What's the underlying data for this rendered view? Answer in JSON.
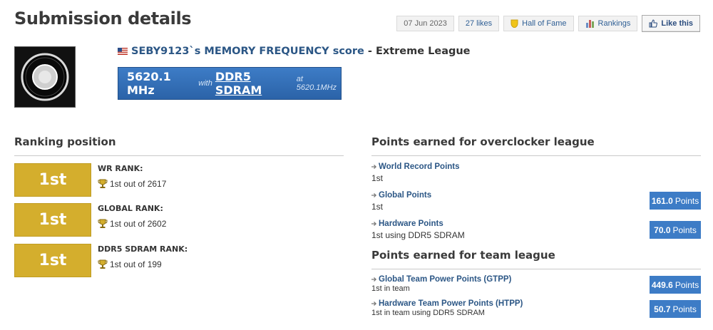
{
  "page_title": "Submission details",
  "top_bar": {
    "date": "07 Jun 2023",
    "likes": "27 likes",
    "hall_of_fame": "Hall of Fame",
    "rankings": "Rankings",
    "like_this": "Like this"
  },
  "submission": {
    "user_score": "SEBY9123`s MEMORY FREQUENCY score",
    "league": "- Extreme League",
    "score_value": "5620.1 MHz",
    "with_text": "with",
    "memory_type": "DDR5 SDRAM",
    "at_text": "at 5620.1MHz"
  },
  "ranking": {
    "title": "Ranking position",
    "rows": [
      {
        "position": "1st",
        "label": "WR RANK:",
        "detail": "1st out of 2617"
      },
      {
        "position": "1st",
        "label": "GLOBAL RANK:",
        "detail": "1st out of 2602"
      },
      {
        "position": "1st",
        "label": "DDR5 SDRAM RANK:",
        "detail": "1st out of 199"
      }
    ]
  },
  "overclocker_league": {
    "title": "Points earned for overclocker league",
    "items": [
      {
        "title": "World Record Points",
        "sub": "1st",
        "points": "",
        "unit": ""
      },
      {
        "title": "Global Points",
        "sub": "1st",
        "points": "161.0",
        "unit": "Points"
      },
      {
        "title": "Hardware Points",
        "sub": "1st using DDR5 SDRAM",
        "points": "70.0",
        "unit": "Points"
      }
    ]
  },
  "team_league": {
    "title": "Points earned for team league",
    "items": [
      {
        "title": "Global Team Power Points (GTPP)",
        "sub": "1st in team",
        "points": "449.6",
        "unit": "Points"
      },
      {
        "title": "Hardware Team Power Points (HTPP)",
        "sub": "1st in team using DDR5 SDRAM",
        "points": "50.7",
        "unit": "Points"
      }
    ]
  },
  "colors": {
    "gold": "#d4ae2d",
    "blue": "#3d7cc6",
    "link": "#2b5685"
  },
  "icons": [
    "hall-of-fame-icon",
    "rankings-icon",
    "thumbs-up-icon",
    "flag-icon",
    "trophy-icon",
    "arrow-icon"
  ]
}
